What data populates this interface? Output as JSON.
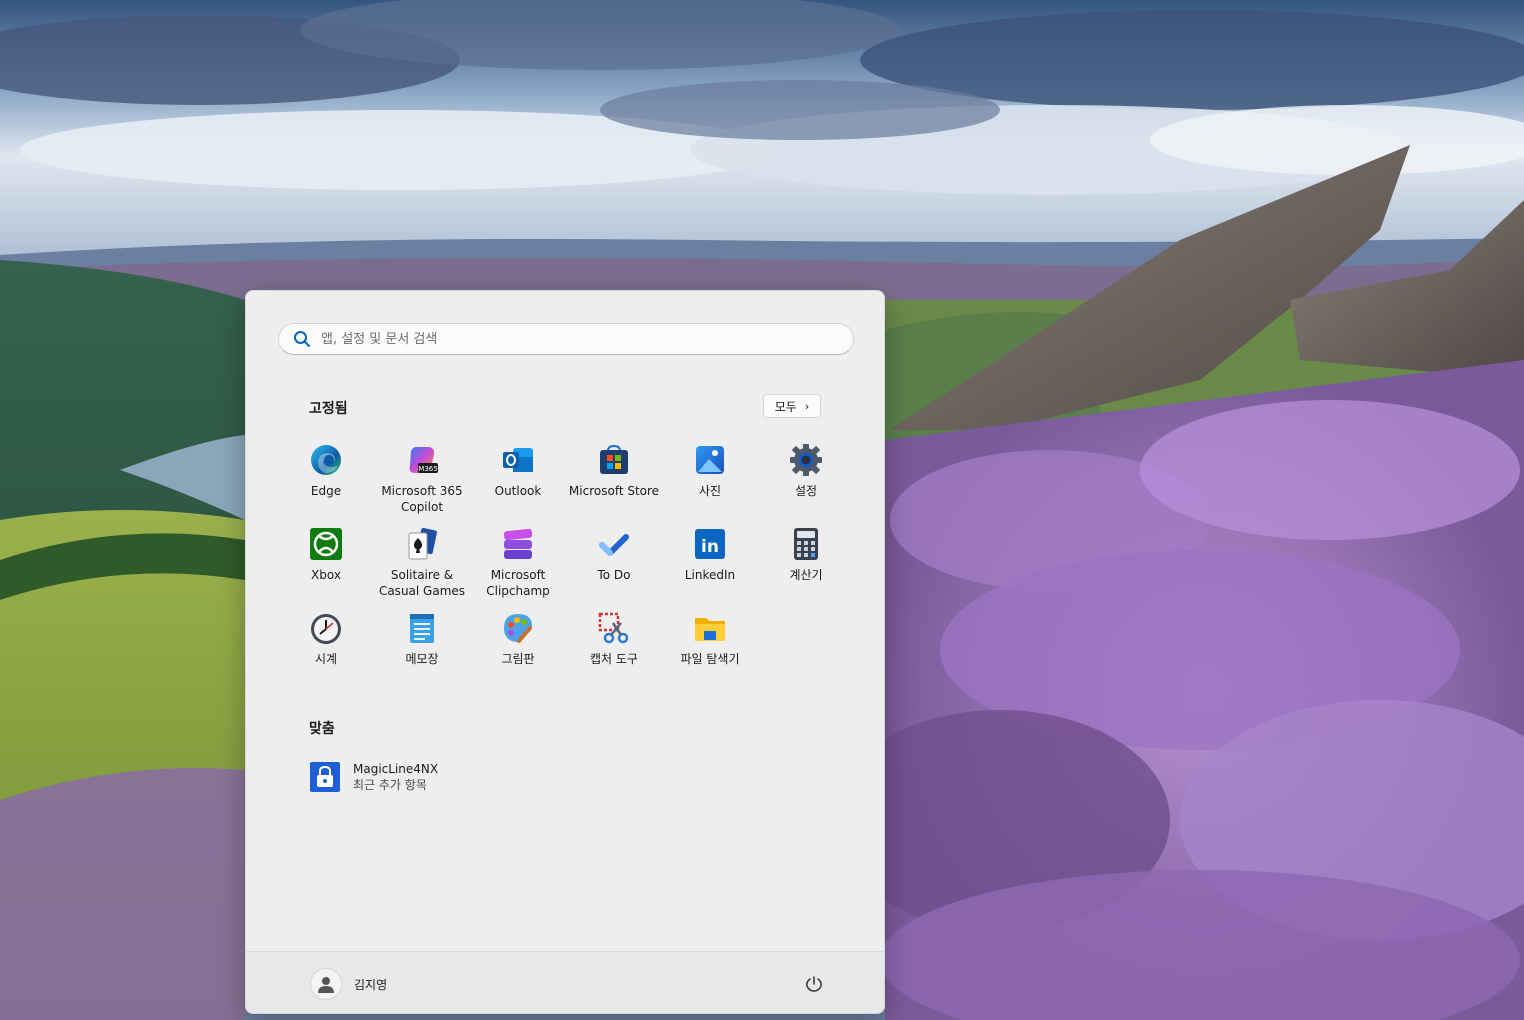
{
  "search": {
    "placeholder": "앱, 설정 및 문서 검색"
  },
  "pinned": {
    "title": "고정됨",
    "all_button": "모두",
    "apps": [
      {
        "label": "Edge",
        "icon": "edge-icon"
      },
      {
        "label": "Microsoft 365\nCopilot",
        "icon": "m365-copilot-icon",
        "badge": "M365"
      },
      {
        "label": "Outlook",
        "icon": "outlook-icon"
      },
      {
        "label": "Microsoft Store",
        "icon": "store-icon"
      },
      {
        "label": "사진",
        "icon": "photos-icon"
      },
      {
        "label": "설정",
        "icon": "settings-gear-icon"
      },
      {
        "label": "Xbox",
        "icon": "xbox-icon"
      },
      {
        "label": "Solitaire &\nCasual Games",
        "icon": "solitaire-icon"
      },
      {
        "label": "Microsoft\nClipchamp",
        "icon": "clipchamp-icon"
      },
      {
        "label": "To Do",
        "icon": "todo-icon"
      },
      {
        "label": "LinkedIn",
        "icon": "linkedin-icon",
        "badge": "in"
      },
      {
        "label": "계산기",
        "icon": "calculator-icon"
      },
      {
        "label": "시계",
        "icon": "clock-icon"
      },
      {
        "label": "메모장",
        "icon": "notepad-icon"
      },
      {
        "label": "그림판",
        "icon": "paint-icon"
      },
      {
        "label": "캡처 도구",
        "icon": "snipping-tool-icon"
      },
      {
        "label": "파일 탐색기",
        "icon": "file-explorer-icon"
      }
    ]
  },
  "recommended": {
    "title": "맞춤",
    "items": [
      {
        "name": "MagicLine4NX",
        "subtitle": "최근 추가 항목",
        "icon": "lock-app-icon"
      }
    ]
  },
  "user": {
    "name": "김지영"
  },
  "colors": {
    "accent": "#0067c0",
    "panel_bg": "#eeeeee"
  }
}
